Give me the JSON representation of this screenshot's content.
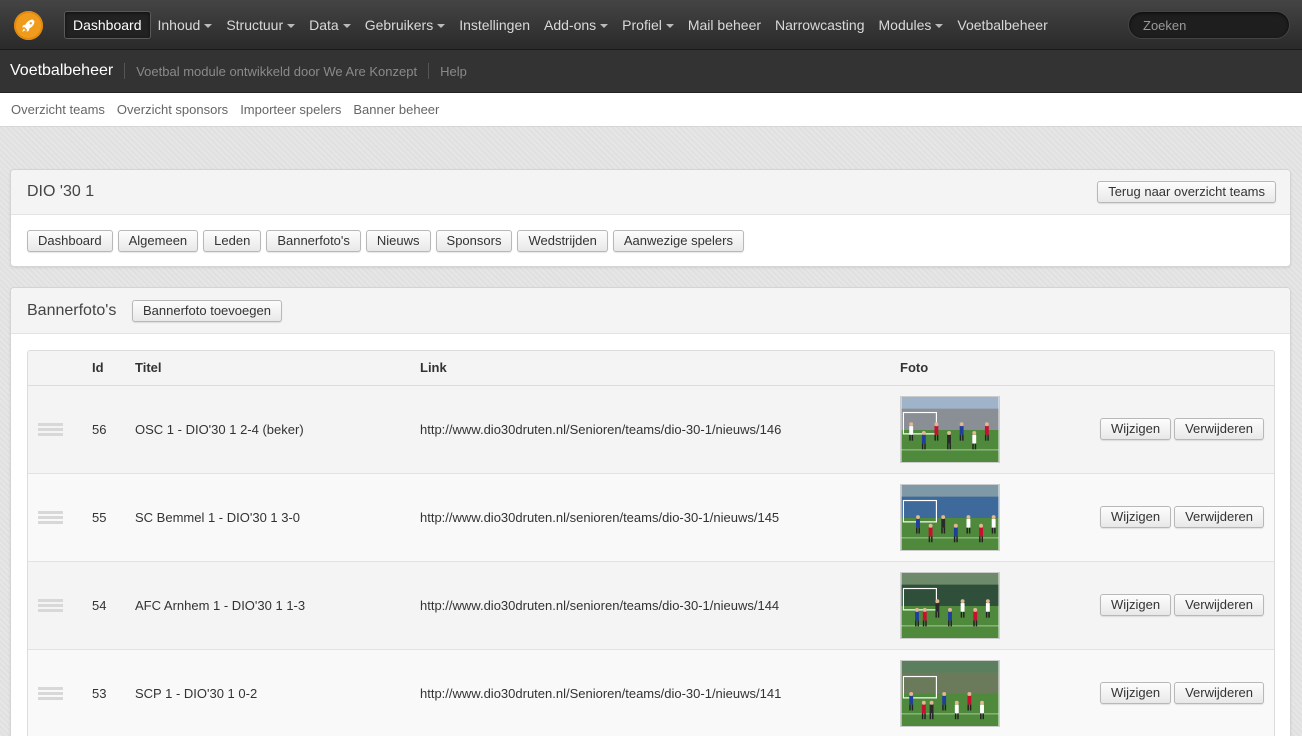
{
  "topnav": {
    "items": [
      {
        "label": "Dashboard",
        "dropdown": false,
        "active": true
      },
      {
        "label": "Inhoud",
        "dropdown": true
      },
      {
        "label": "Structuur",
        "dropdown": true
      },
      {
        "label": "Data",
        "dropdown": true
      },
      {
        "label": "Gebruikers",
        "dropdown": true
      },
      {
        "label": "Instellingen",
        "dropdown": false
      },
      {
        "label": "Add-ons",
        "dropdown": true
      },
      {
        "label": "Profiel",
        "dropdown": true
      },
      {
        "label": "Mail beheer",
        "dropdown": false
      },
      {
        "label": "Narrowcasting",
        "dropdown": false
      },
      {
        "label": "Modules",
        "dropdown": true
      },
      {
        "label": "Voetbalbeheer",
        "dropdown": false
      }
    ],
    "search_placeholder": "Zoeken",
    "logo_icon": "rocket-icon",
    "logo_color": "#f19b1c"
  },
  "module_bar": {
    "title": "Voetbalbeheer",
    "description": "Voetbal module ontwikkeld door We Are Konzept",
    "help": "Help"
  },
  "submenu": [
    "Overzicht teams",
    "Overzicht sponsors",
    "Importeer spelers",
    "Banner beheer"
  ],
  "team_panel": {
    "title": "DIO '30 1",
    "back_button": "Terug naar overzicht teams",
    "tabs": [
      "Dashboard",
      "Algemeen",
      "Leden",
      "Bannerfoto's",
      "Nieuws",
      "Sponsors",
      "Wedstrijden",
      "Aanwezige spelers"
    ]
  },
  "banner_panel": {
    "title": "Bannerfoto's",
    "add_button": "Bannerfoto toevoegen",
    "columns": {
      "id": "Id",
      "title": "Titel",
      "link": "Link",
      "photo": "Foto"
    },
    "edit_label": "Wijzigen",
    "delete_label": "Verwijderen",
    "rows": [
      {
        "id": "56",
        "title": "OSC 1 - DIO'30 1 2-4 (beker)",
        "link": "http://www.dio30druten.nl/Senioren/teams/dio-30-1/nieuws/146"
      },
      {
        "id": "55",
        "title": "SC Bemmel 1 - DIO'30 1 3-0",
        "link": "http://www.dio30druten.nl/senioren/teams/dio-30-1/nieuws/145"
      },
      {
        "id": "54",
        "title": "AFC Arnhem 1 - DIO'30 1 1-3",
        "link": "http://www.dio30druten.nl/senioren/teams/dio-30-1/nieuws/144"
      },
      {
        "id": "53",
        "title": "SCP 1 - DIO'30 1 0-2",
        "link": "http://www.dio30druten.nl/Senioren/teams/dio-30-1/nieuws/141"
      }
    ]
  }
}
